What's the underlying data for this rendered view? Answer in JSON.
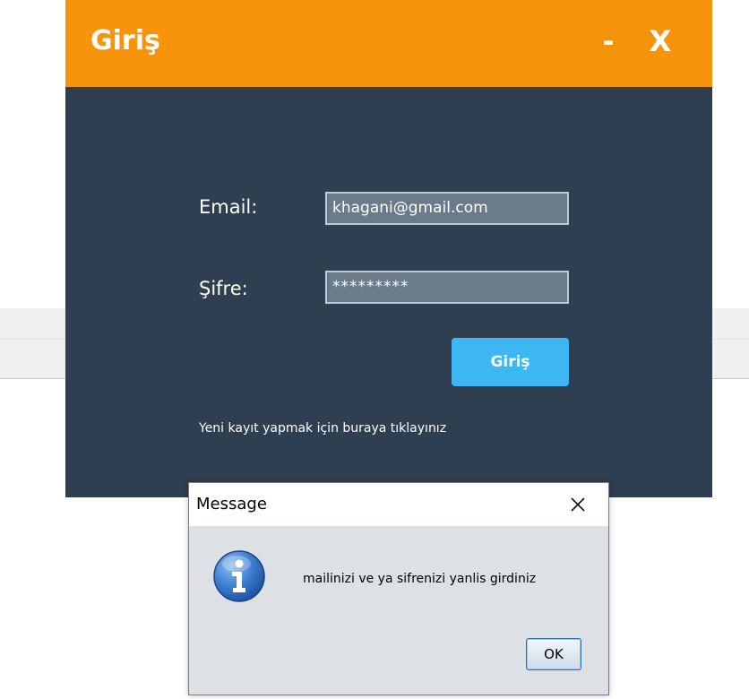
{
  "login_window": {
    "title": "Giriş",
    "minimize_label": "-",
    "close_label": "X",
    "email_label": "Email:",
    "email_value": "khagani@gmail.com",
    "password_label": "Şifre:",
    "password_value": "*********",
    "login_button_label": "Giriş",
    "register_link": "Yeni kayıt yapmak için buraya tıklayınız",
    "colors": {
      "title_bar": "#f7940c",
      "body": "#2f3e50",
      "button": "#3db7f3",
      "input": "#6b7b8c"
    }
  },
  "dialog": {
    "title": "Message",
    "message": "mailinizi ve ya sifrenizi yanlis girdiniz",
    "ok_label": "OK",
    "icon": "info-icon",
    "close_icon": "close-icon"
  }
}
